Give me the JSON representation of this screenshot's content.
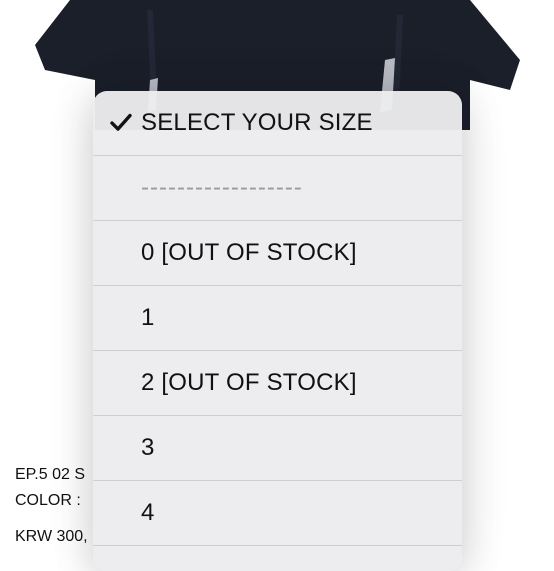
{
  "product": {
    "name_line": "EP.5 02 S",
    "color_line": "COLOR :",
    "price_line": "KRW 300,"
  },
  "size_picker": {
    "options": [
      {
        "label": "SELECT YOUR SIZE",
        "selected": true
      },
      {
        "label": "------------------",
        "selected": false
      },
      {
        "label": "0 [OUT OF STOCK]",
        "selected": false
      },
      {
        "label": "1",
        "selected": false
      },
      {
        "label": "2 [OUT OF STOCK]",
        "selected": false
      },
      {
        "label": "3",
        "selected": false
      },
      {
        "label": "4",
        "selected": false
      }
    ]
  },
  "colors": {
    "garment": "#1b1f2a",
    "picker_bg": "#ececee",
    "divider": "#cfcfd3",
    "text": "#111111"
  },
  "icons": {
    "selected_marker": "checkmark-icon"
  }
}
